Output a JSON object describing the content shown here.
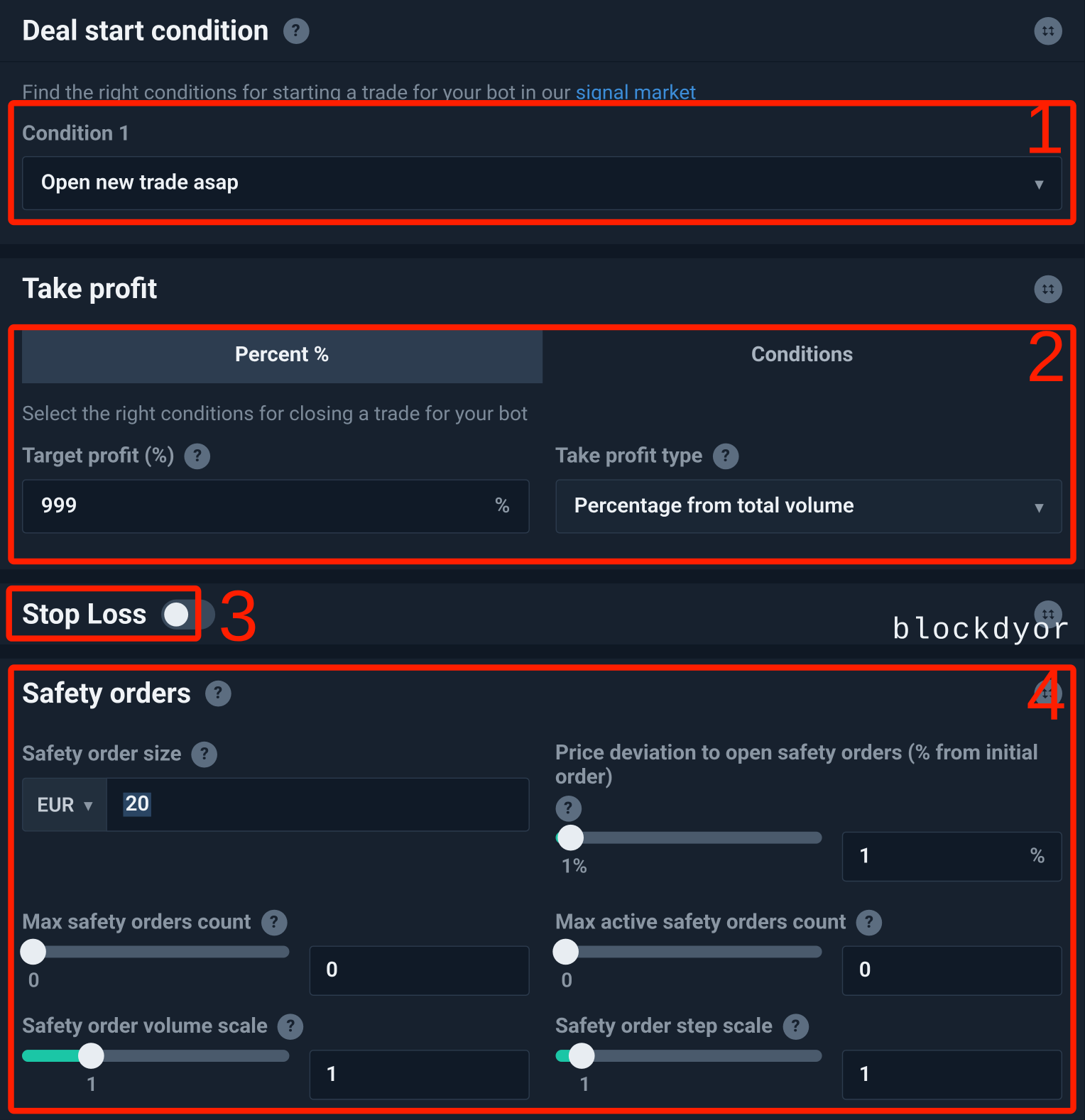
{
  "deal_start": {
    "title": "Deal start condition",
    "hint_pre": "Find the right conditions for starting a trade for your bot in our ",
    "hint_link": "signal market",
    "condition_label": "Condition 1",
    "condition_value": "Open new trade asap"
  },
  "take_profit": {
    "title": "Take profit",
    "tab_percent": "Percent %",
    "tab_conditions": "Conditions",
    "hint": "Select the right conditions for closing a trade for your bot",
    "target_label": "Target profit (%)",
    "target_value": "999",
    "target_suffix": "%",
    "type_label": "Take profit type",
    "type_value": "Percentage from total volume"
  },
  "stop_loss": {
    "title": "Stop Loss",
    "enabled": false
  },
  "safety": {
    "title": "Safety orders",
    "size_label": "Safety order size",
    "currency": "EUR",
    "size_value": "20",
    "pd_label": "Price deviation to open safety orders (% from initial order)",
    "pd_slider_value": "1%",
    "pd_input_value": "1",
    "pd_input_suffix": "%",
    "max_count_label": "Max safety orders count",
    "max_count_slider_value": "0",
    "max_count_input_value": "0",
    "max_active_label": "Max active safety orders count",
    "max_active_slider_value": "0",
    "max_active_input_value": "0",
    "vol_scale_label": "Safety order volume scale",
    "vol_scale_slider_value": "1",
    "vol_scale_input_value": "1",
    "step_scale_label": "Safety order step scale",
    "step_scale_slider_value": "1",
    "step_scale_input_value": "1"
  },
  "annotations": {
    "n1": "1",
    "n2": "2",
    "n3": "3",
    "n4": "4"
  },
  "watermark": "blockdyor"
}
